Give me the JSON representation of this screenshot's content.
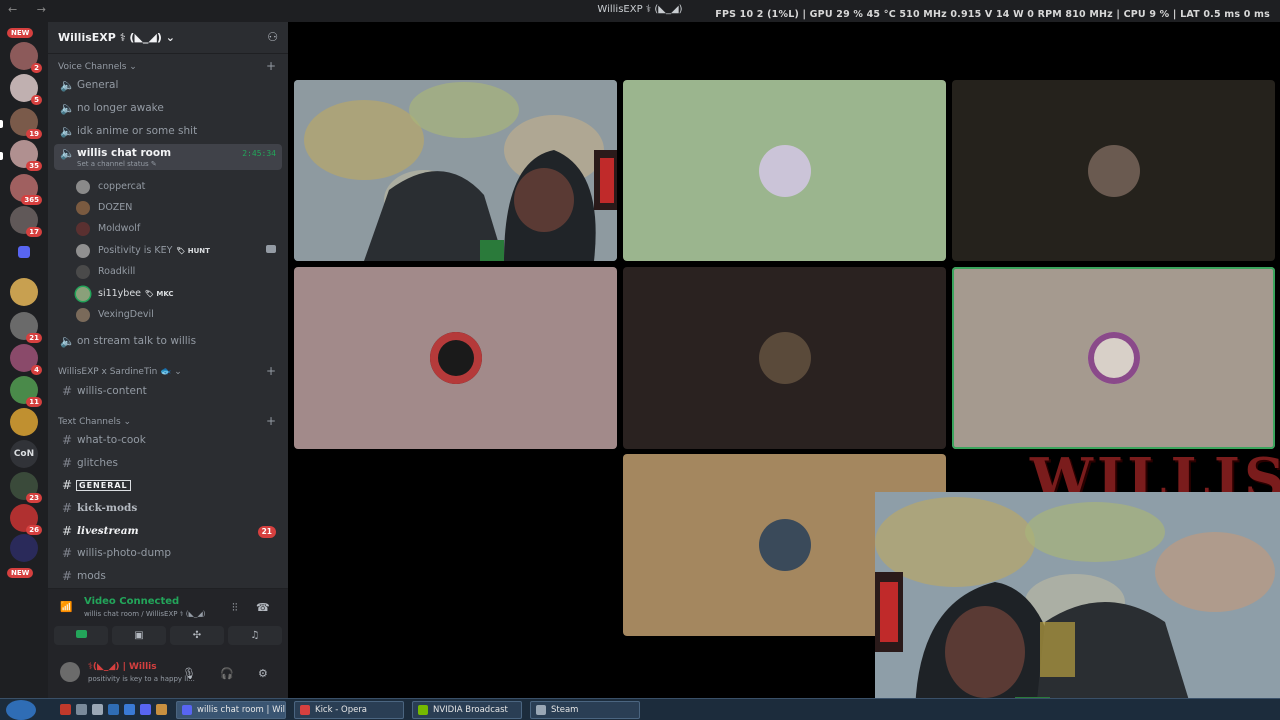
{
  "window": {
    "title": "WillisEXP ⚕ (◣_◢)",
    "nav": "← →",
    "perf_overlay": "FPS  10   2 (1%L)  |  GPU  29 %  45 °C  510 MHz  0.915 V  14 W  0 RPM  810 MHz  |  CPU  9 %  |  LAT  0.5 ms  0 ms"
  },
  "servers": {
    "new_label": "NEW",
    "badges": [
      "2",
      "5",
      "19",
      "35",
      "365",
      "17",
      "21",
      "4",
      "11",
      "23",
      "26"
    ],
    "text_server": "CoN"
  },
  "guild": {
    "name": "WillisEXP ⚕ (◣_◢) ⌄",
    "voice_category": "Voice Channels ⌄",
    "voice_channels": [
      "General",
      "no longer awake",
      "idk anime or some shit"
    ],
    "active_voice": {
      "name": "willis chat room",
      "status": "Set a channel status ✎",
      "timer": "2:45:34"
    },
    "members": [
      {
        "name": "coppercat",
        "tag": ""
      },
      {
        "name": "DOZEN",
        "tag": ""
      },
      {
        "name": "Moldwolf",
        "tag": ""
      },
      {
        "name": "Positivity is KEY",
        "tag": "🏷 HUNT"
      },
      {
        "name": "Roadkill",
        "tag": ""
      },
      {
        "name": "si11ybee",
        "tag": "🏷 MKC"
      },
      {
        "name": "VexingDevil",
        "tag": ""
      }
    ],
    "voice_after": "on stream talk to willis",
    "collab_category": "WillisEXP x SardineTin 🐟 ⌄",
    "collab_channel": "willis-content",
    "text_category": "Text Channels ⌄",
    "text_channels": [
      {
        "name": "what-to-cook",
        "unread": ""
      },
      {
        "name": "glitches",
        "unread": ""
      },
      {
        "name": "GENERAL",
        "unread": ""
      },
      {
        "name": "kick-mods",
        "unread": ""
      },
      {
        "name": "livestream",
        "unread": "21"
      },
      {
        "name": "willis-photo-dump",
        "unread": ""
      },
      {
        "name": "mods",
        "unread": ""
      }
    ]
  },
  "rtc": {
    "status": "Video Connected",
    "location": "willis chat room / WillisEXP ⚕ (◣_◢)",
    "buttons": [
      "camera",
      "screen-share",
      "activities",
      "soundboard"
    ]
  },
  "user": {
    "name": "⚕(◣_◢) | Willis",
    "status": "positivity is key to a happy li..."
  },
  "overlay": {
    "title": "WILLIS"
  },
  "taskbar": {
    "tasks": [
      {
        "label": "willis chat room | Will...",
        "color": "#5865f2"
      },
      {
        "label": "Kick - Opera",
        "color": "#d6403f"
      },
      {
        "label": "NVIDIA Broadcast",
        "color": "#76b900"
      },
      {
        "label": "Steam",
        "color": "#9aa7b5"
      }
    ]
  },
  "tiles_colors": {
    "t2": "#9bb58e",
    "t3": "#25221c",
    "t4": "#a28a8a",
    "t5": "#2a2220",
    "t6": "#a59a8f",
    "t7": "#a4875f"
  }
}
